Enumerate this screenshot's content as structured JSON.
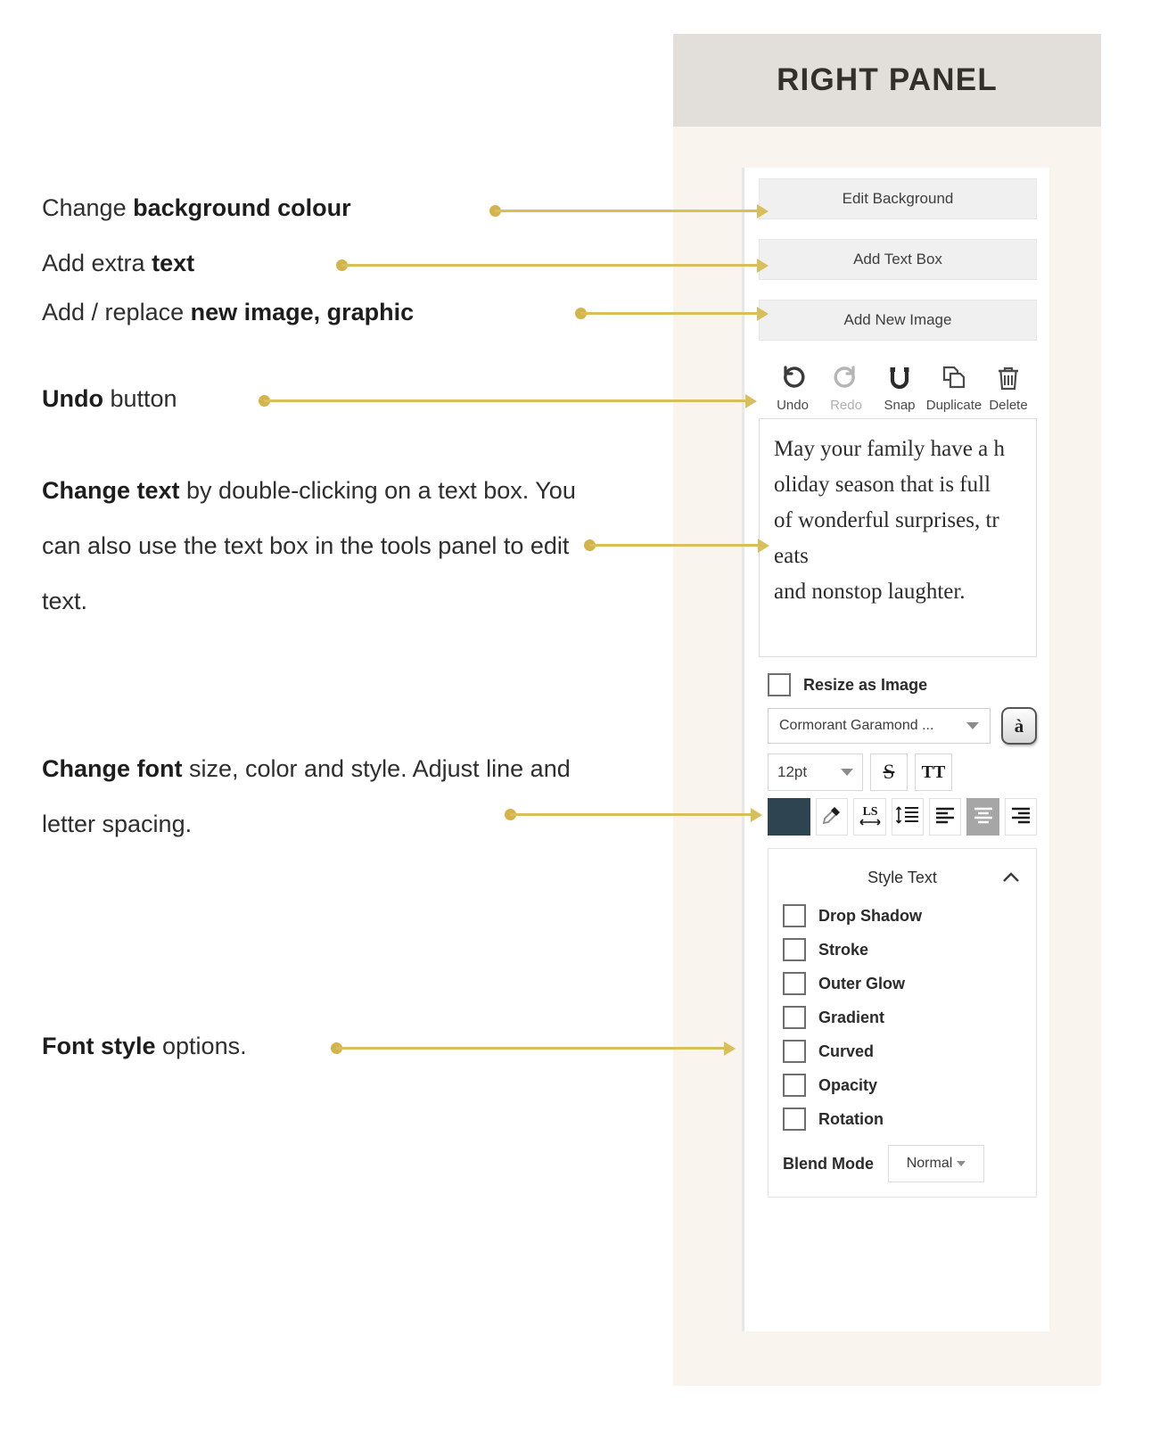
{
  "header": {
    "title": "RIGHT PANEL"
  },
  "panel": {
    "buttons": [
      {
        "label": "Edit Background",
        "name": "edit-background-button"
      },
      {
        "label": "Add Text Box",
        "name": "add-text-box-button"
      },
      {
        "label": "Add New Image",
        "name": "add-new-image-button"
      }
    ],
    "tools": [
      {
        "label": "Undo",
        "icon": "undo-icon",
        "disabled": false
      },
      {
        "label": "Redo",
        "icon": "redo-icon",
        "disabled": true
      },
      {
        "label": "Snap",
        "icon": "magnet-icon",
        "disabled": false
      },
      {
        "label": "Duplicate",
        "icon": "duplicate-icon",
        "disabled": false
      },
      {
        "label": "Delete",
        "icon": "trash-icon",
        "disabled": false
      }
    ],
    "text_preview": {
      "lines": [
        "May your family have a h",
        "oliday season that is full",
        "of wonderful surprises, tr",
        "eats",
        "and nonstop laughter."
      ]
    },
    "resize_as_image": {
      "label": "Resize as Image",
      "checked": false
    },
    "font": {
      "family_value": "Cormorant Garamond ...",
      "accent_key_glyph": "à",
      "size_value": "12pt",
      "strikethrough_glyph": "S",
      "caps_glyph": "TT",
      "color_swatch": "#2e4450",
      "letter_spacing_glyph": "LS",
      "alignment_active": "center"
    },
    "style_text": {
      "title": "Style Text",
      "expanded": true,
      "options": [
        {
          "label": "Drop Shadow",
          "checked": false
        },
        {
          "label": "Stroke",
          "checked": false
        },
        {
          "label": "Outer Glow",
          "checked": false
        },
        {
          "label": "Gradient",
          "checked": false
        },
        {
          "label": "Curved",
          "checked": false
        },
        {
          "label": "Opacity",
          "checked": false
        },
        {
          "label": "Rotation",
          "checked": false
        }
      ],
      "blend_mode": {
        "label": "Blend Mode",
        "value": "Normal"
      }
    }
  },
  "annotations": {
    "a1_plain": "Change ",
    "a1_bold": "background colour",
    "a2_plain": "Add extra ",
    "a2_bold": "text",
    "a3_plain": "Add / replace ",
    "a3_bold": "new image, graphic",
    "a4_bold": "Undo",
    "a4_plain": "  button",
    "a5_bold": "Change text",
    "a5_plain": " by double-clicking on a text box. You can also use the text box in the tools panel to edit text.",
    "a6_bold": "Change font",
    "a6_plain": " size, color and style. Adjust line and letter spacing.",
    "a7_bold": "Font style",
    "a7_plain": " options."
  },
  "colors": {
    "accent": "#d9bf5c",
    "header_bg": "#e2dfda",
    "panel_bg": "#faf4ee"
  }
}
